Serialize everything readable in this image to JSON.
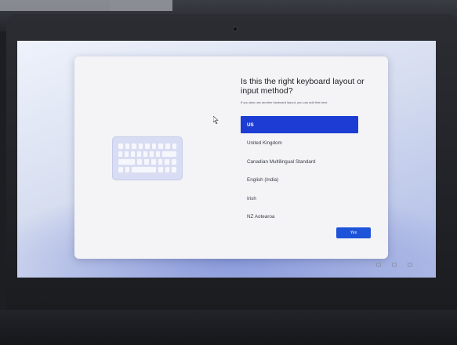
{
  "dialog": {
    "title": "Is this the right keyboard layout or input method?",
    "subtitle": "If you also use another keyboard layout, you can add that next.",
    "layouts": [
      {
        "label": "US",
        "selected": true
      },
      {
        "label": "United Kingdom",
        "selected": false
      },
      {
        "label": "Canadian Multilingual Standard",
        "selected": false
      },
      {
        "label": "English (India)",
        "selected": false
      },
      {
        "label": "Irish",
        "selected": false
      },
      {
        "label": "NZ Aotearoa",
        "selected": false
      }
    ],
    "yes_label": "Yes"
  },
  "illustration": {
    "icon": "keyboard-icon"
  },
  "tray": {
    "icons": [
      "accessibility-icon",
      "network-icon",
      "volume-icon"
    ]
  },
  "colors": {
    "accent": "#1d3cd4",
    "button": "#1d53d8",
    "dialog_bg": "#f4f4f6",
    "keyboard_bg": "#d9ddf3"
  }
}
